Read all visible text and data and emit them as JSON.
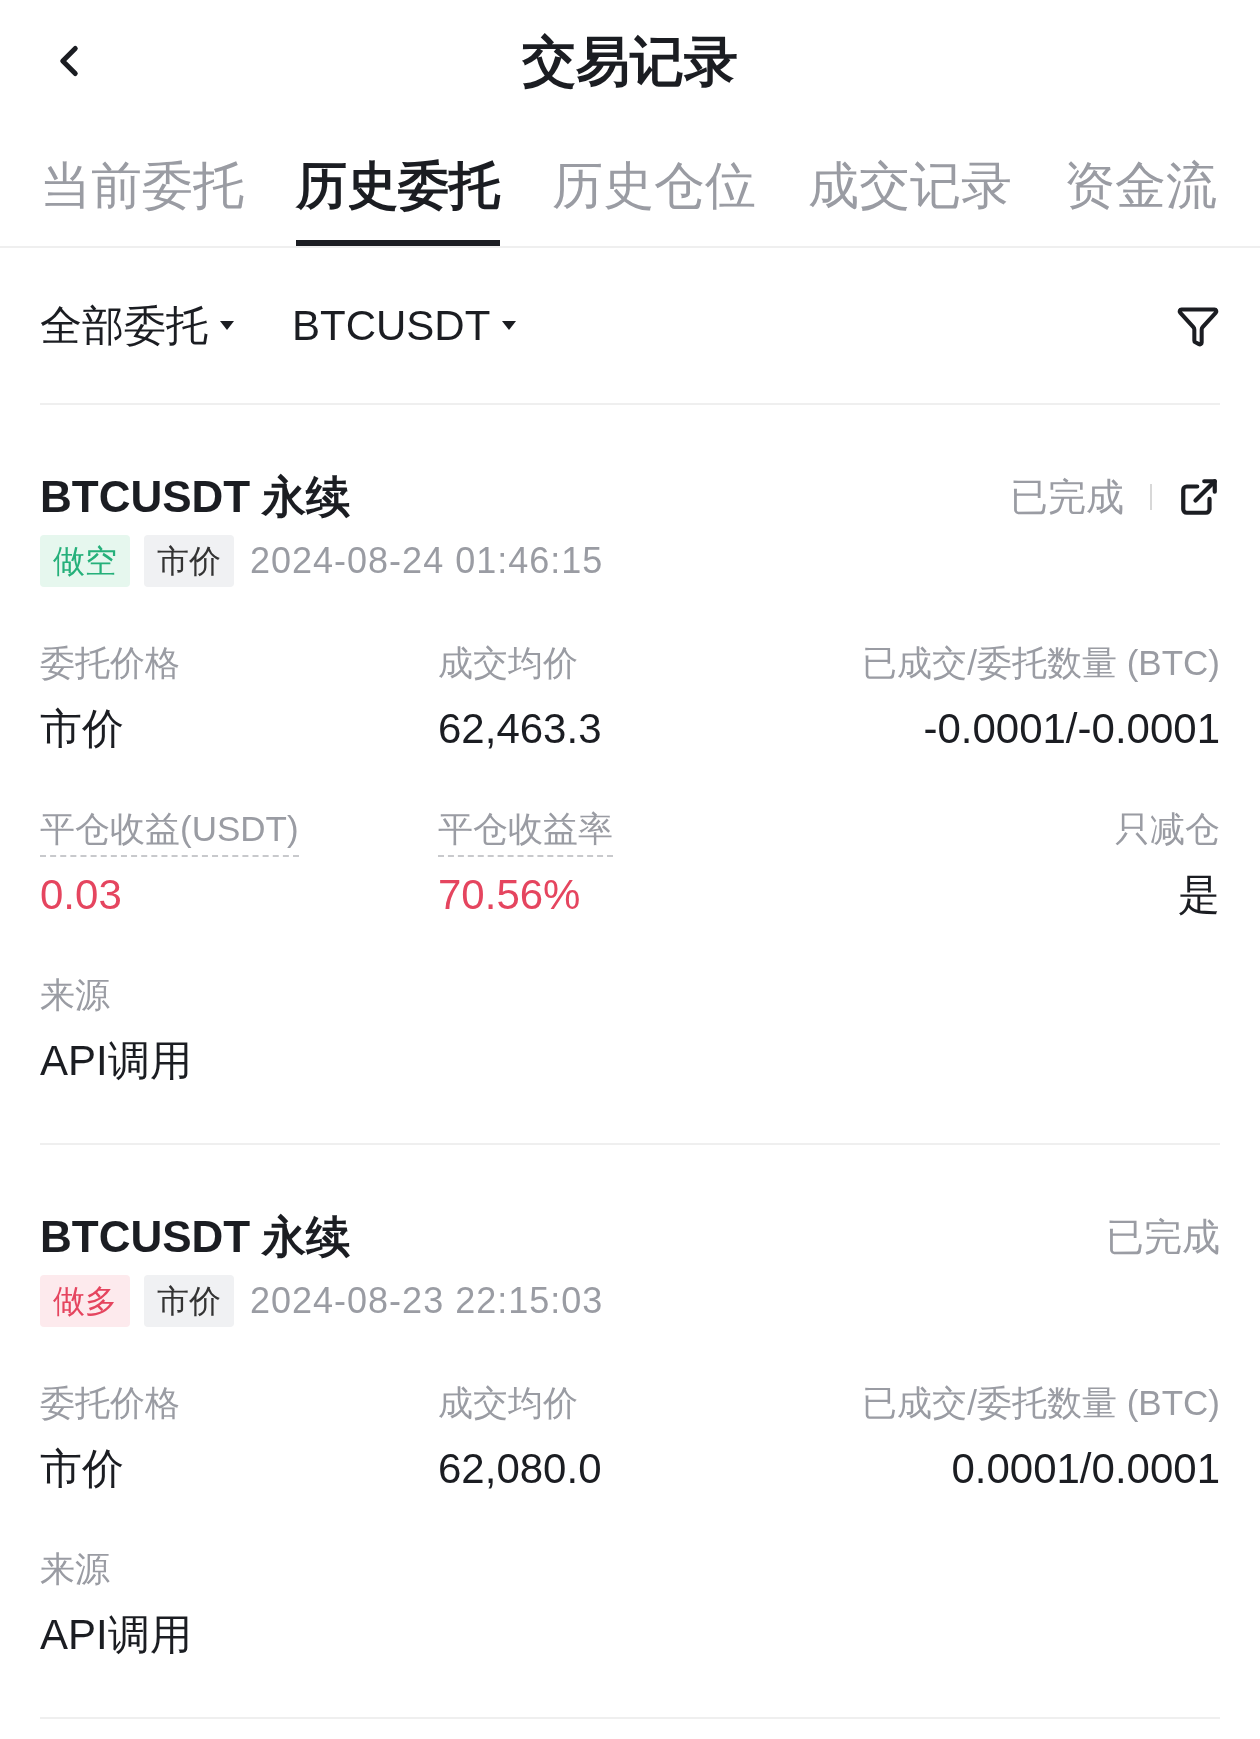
{
  "header": {
    "title": "交易记录"
  },
  "tabs": [
    {
      "label": "当前委托",
      "selected": false
    },
    {
      "label": "历史委托",
      "selected": true
    },
    {
      "label": "历史仓位",
      "selected": false
    },
    {
      "label": "成交记录",
      "selected": false
    },
    {
      "label": "资金流",
      "selected": false
    }
  ],
  "filters": [
    {
      "label": "全部委托"
    },
    {
      "label": "BTCUSDT"
    }
  ],
  "orders": [
    {
      "symbol": "BTCUSDT 永续",
      "status": "已完成",
      "shareable": true,
      "tags": [
        {
          "label": "做空",
          "kind": "short"
        },
        {
          "label": "市价",
          "kind": "type"
        }
      ],
      "time": "2024-08-24 01:46:15",
      "rows": [
        [
          {
            "label": "委托价格",
            "value": "市价",
            "underlined": false
          },
          {
            "label": "成交均价",
            "value": "62,463.3",
            "underlined": false
          },
          {
            "label": "已成交/委托数量 (BTC)",
            "value": "-0.0001/-0.0001",
            "underlined": false
          }
        ],
        [
          {
            "label": "平仓收益(USDT)",
            "value": "0.03",
            "underlined": true,
            "color": "#e5455f"
          },
          {
            "label": "平仓收益率",
            "value": "70.56%",
            "underlined": true,
            "color": "#e5455f"
          },
          {
            "label": "只减仓",
            "value": "是",
            "underlined": false
          }
        ],
        [
          {
            "label": "来源",
            "value": "API调用",
            "underlined": false
          }
        ]
      ]
    },
    {
      "symbol": "BTCUSDT 永续",
      "status": "已完成",
      "shareable": false,
      "tags": [
        {
          "label": "做多",
          "kind": "long"
        },
        {
          "label": "市价",
          "kind": "type"
        }
      ],
      "time": "2024-08-23 22:15:03",
      "rows": [
        [
          {
            "label": "委托价格",
            "value": "市价",
            "underlined": false
          },
          {
            "label": "成交均价",
            "value": "62,080.0",
            "underlined": false
          },
          {
            "label": "已成交/委托数量 (BTC)",
            "value": "0.0001/0.0001",
            "underlined": false
          }
        ],
        [
          {
            "label": "来源",
            "value": "API调用",
            "underlined": false
          }
        ]
      ]
    }
  ]
}
